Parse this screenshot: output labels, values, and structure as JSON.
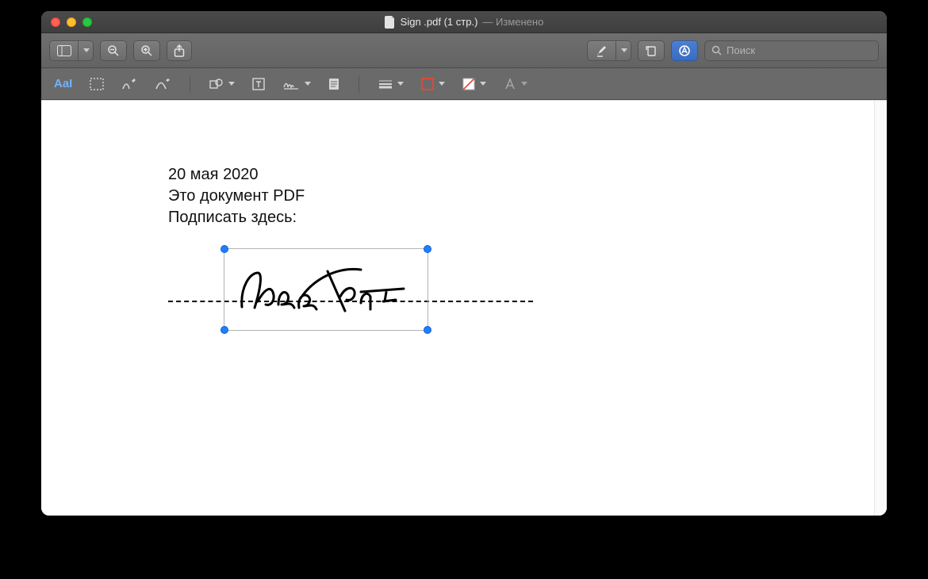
{
  "window": {
    "title_main": "Sign .pdf (1 стр.)",
    "title_suffix": " — Изменено"
  },
  "toolbar": {
    "search_placeholder": "Поиск"
  },
  "markup": {
    "textstyle_label": "AaI"
  },
  "document": {
    "line1": "20 мая 2020",
    "line2": "Это документ PDF",
    "line3": "Подписать здесь:"
  }
}
